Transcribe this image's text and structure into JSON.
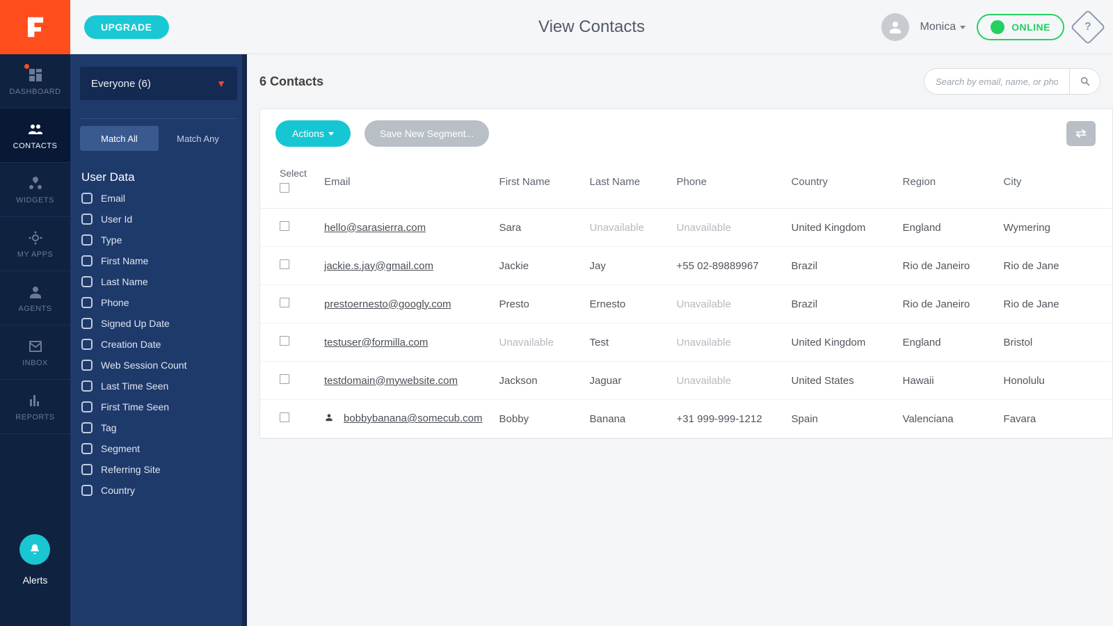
{
  "topbar": {
    "upgrade": "UPGRADE",
    "title": "View Contacts",
    "user_name": "Monica",
    "online_label": "ONLINE",
    "help_glyph": "?"
  },
  "nav": {
    "items": [
      {
        "id": "dashboard",
        "label": "DASHBOARD",
        "badge": true
      },
      {
        "id": "contacts",
        "label": "CONTACTS",
        "active": true
      },
      {
        "id": "widgets",
        "label": "WIDGETS"
      },
      {
        "id": "myapps",
        "label": "MY APPS"
      },
      {
        "id": "agents",
        "label": "AGENTS"
      },
      {
        "id": "inbox",
        "label": "INBOX"
      },
      {
        "id": "reports",
        "label": "REPORTS"
      }
    ],
    "alerts_label": "Alerts"
  },
  "filter": {
    "segment_label": "Everyone (6)",
    "match_all": "Match All",
    "match_any": "Match Any",
    "section": "User Data",
    "fields": [
      "Email",
      "User Id",
      "Type",
      "First Name",
      "Last Name",
      "Phone",
      "Signed Up Date",
      "Creation Date",
      "Web Session Count",
      "Last Time Seen",
      "First Time Seen",
      "Tag",
      "Segment",
      "Referring Site",
      "Country"
    ]
  },
  "main": {
    "count_label": "6 Contacts",
    "search_placeholder": "Search by email, name, or phone",
    "actions_label": "Actions",
    "save_segment_label": "Save New Segment...",
    "columns": {
      "select": "Select",
      "email": "Email",
      "first": "First Name",
      "last": "Last Name",
      "phone": "Phone",
      "country": "Country",
      "region": "Region",
      "city": "City"
    },
    "rows": [
      {
        "email": "hello@sarasierra.com",
        "first": "Sara",
        "last": "Unavailable",
        "phone": "Unavailable",
        "country": "United Kingdom",
        "region": "England",
        "city": "Wymering",
        "person": false
      },
      {
        "email": "jackie.s.jay@gmail.com",
        "first": "Jackie",
        "last": "Jay",
        "phone": "+55 02-89889967",
        "country": "Brazil",
        "region": "Rio de Janeiro",
        "city": "Rio de Jane",
        "person": false
      },
      {
        "email": "prestoernesto@googly.com",
        "first": "Presto",
        "last": "Ernesto",
        "phone": "Unavailable",
        "country": "Brazil",
        "region": "Rio de Janeiro",
        "city": "Rio de Jane",
        "person": false
      },
      {
        "email": "testuser@formilla.com",
        "first": "Unavailable",
        "last": "Test",
        "phone": "Unavailable",
        "country": "United Kingdom",
        "region": "England",
        "city": "Bristol",
        "person": false
      },
      {
        "email": "testdomain@mywebsite.com",
        "first": "Jackson",
        "last": "Jaguar",
        "phone": "Unavailable",
        "country": "United States",
        "region": "Hawaii",
        "city": "Honolulu",
        "person": false
      },
      {
        "email": "bobbybanana@somecub.com",
        "first": "Bobby",
        "last": "Banana",
        "phone": "+31 999-999-1212",
        "country": "Spain",
        "region": "Valenciana",
        "city": "Favara",
        "person": true
      }
    ]
  }
}
